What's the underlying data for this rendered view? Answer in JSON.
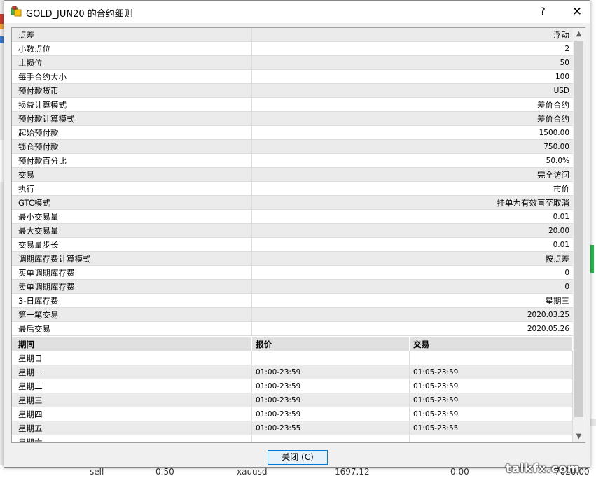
{
  "dialog": {
    "title": "GOLD_JUN20 的合约细则",
    "help_label": "?",
    "close_icon": "✕",
    "close_button_label": "关闭 (C)"
  },
  "properties": [
    {
      "name": "点差",
      "value": "浮动"
    },
    {
      "name": "小数点位",
      "value": "2"
    },
    {
      "name": "止损位",
      "value": "50"
    },
    {
      "name": "每手合约大小",
      "value": "100"
    },
    {
      "name": "预付款货币",
      "value": "USD"
    },
    {
      "name": "损益计算模式",
      "value": "差价合约"
    },
    {
      "name": "预付款计算模式",
      "value": "差价合约"
    },
    {
      "name": "起始预付款",
      "value": "1500.00"
    },
    {
      "name": "锁仓预付款",
      "value": "750.00"
    },
    {
      "name": "预付款百分比",
      "value": "50.0%"
    },
    {
      "name": "交易",
      "value": "完全访问"
    },
    {
      "name": "执行",
      "value": "市价"
    },
    {
      "name": "GTC模式",
      "value": "挂单为有效直至取消"
    },
    {
      "name": "最小交易量",
      "value": "0.01"
    },
    {
      "name": "最大交易量",
      "value": "20.00"
    },
    {
      "name": "交易量步长",
      "value": "0.01"
    },
    {
      "name": "调期库存费计算模式",
      "value": "按点差"
    },
    {
      "name": "买单调期库存费",
      "value": "0"
    },
    {
      "name": "卖单调期库存费",
      "value": "0"
    },
    {
      "name": "3-日库存费",
      "value": "星期三"
    },
    {
      "name": "第一笔交易",
      "value": "2020.03.25"
    },
    {
      "name": "最后交易",
      "value": "2020.05.26"
    }
  ],
  "schedule": {
    "headers": [
      "期间",
      "报价",
      "交易"
    ],
    "rows": [
      {
        "day": "星期日",
        "quote": "",
        "trade": ""
      },
      {
        "day": "星期一",
        "quote": "01:00-23:59",
        "trade": "01:05-23:59"
      },
      {
        "day": "星期二",
        "quote": "01:00-23:59",
        "trade": "01:05-23:59"
      },
      {
        "day": "星期三",
        "quote": "01:00-23:59",
        "trade": "01:05-23:59"
      },
      {
        "day": "星期四",
        "quote": "01:00-23:59",
        "trade": "01:05-23:59"
      },
      {
        "day": "星期五",
        "quote": "01:00-23:55",
        "trade": "01:05-23:55"
      },
      {
        "day": "星期六",
        "quote": "",
        "trade": ""
      }
    ]
  },
  "background": {
    "row_text": [
      "sell",
      "0.50",
      "xauusd",
      "1697.12",
      "0.00",
      "7020.00"
    ]
  },
  "watermark": "talkfx.com",
  "colors": {
    "accent": "#0078d7",
    "row_alt": "#ebebeb",
    "header_bg": "#e0e0e0"
  }
}
